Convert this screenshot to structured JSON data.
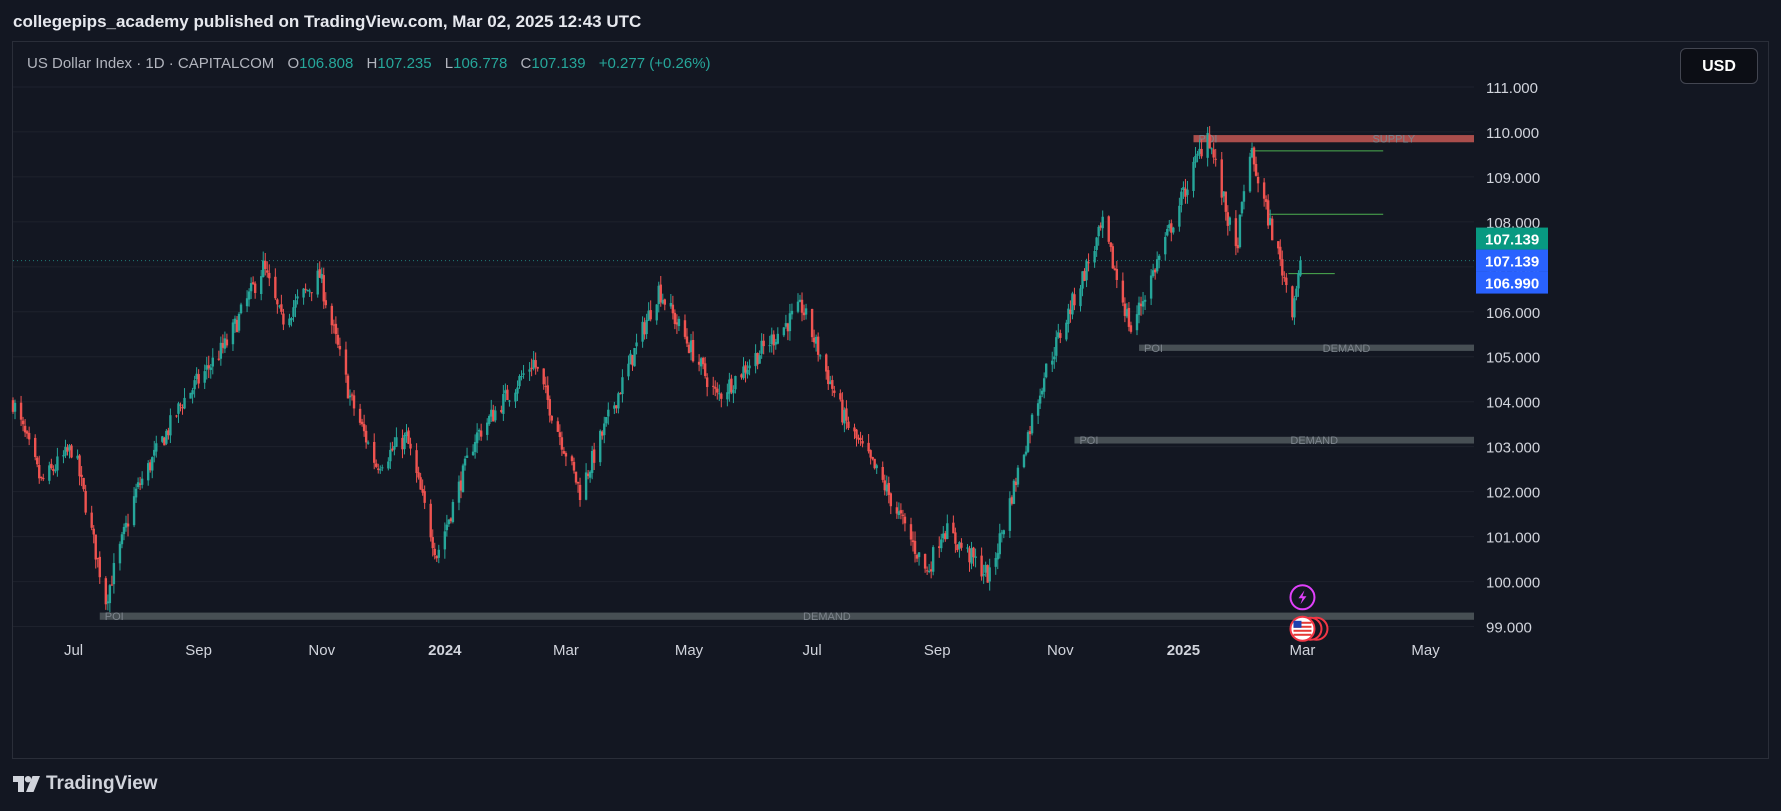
{
  "header": {
    "title": "collegepips_academy published on TradingView.com, Mar 02, 2025 12:43 UTC"
  },
  "legend": {
    "symbol": "US Dollar Index · 1D · CAPITALCOM",
    "o_label": "O",
    "o_value": "106.808",
    "h_label": "H",
    "h_value": "107.235",
    "l_label": "L",
    "l_value": "106.778",
    "c_label": "C",
    "c_value": "107.139",
    "change": "+0.277 (+0.26%)"
  },
  "currency_button": "USD",
  "price_labels": {
    "last": "107.139",
    "close": "107.139",
    "level": "106.990"
  },
  "footer": {
    "brand": "TradingView"
  },
  "colors": {
    "background": "#131722",
    "up": "#26a69a",
    "down": "#ef5350",
    "supply_zone": "#b2514f",
    "demand_zone": "#4a5257",
    "level_line": "#4caf50",
    "price_tag_green": "#089981",
    "price_tag_blue": "#2962ff",
    "event_purple": "#e040fb",
    "event_red": "#f23645"
  },
  "icons": [
    "lightning-event-icon",
    "us-flag-event-icon",
    "tradingview-logo-icon"
  ],
  "chart_data": {
    "type": "candlestick",
    "symbol": "US Dollar Index",
    "interval": "1D",
    "y_ticks": [
      99.0,
      100.0,
      101.0,
      102.0,
      103.0,
      104.0,
      105.0,
      106.0,
      107.0,
      108.0,
      109.0,
      110.0,
      111.0
    ],
    "y_tick_labels": [
      "99.000",
      "100.000",
      "101.000",
      "102.000",
      "103.000",
      "104.000",
      "105.000",
      "106.000",
      "107.000",
      "108.000",
      "109.000",
      "110.000",
      "111.000"
    ],
    "y_range": [
      98.1,
      112.0
    ],
    "x_range": [
      "2023-06-01",
      "2025-05-25"
    ],
    "x_ticks": [
      {
        "date": "2023-07-01",
        "label": "Jul"
      },
      {
        "date": "2023-09-01",
        "label": "Sep"
      },
      {
        "date": "2023-11-01",
        "label": "Nov"
      },
      {
        "date": "2024-01-01",
        "label": "2024"
      },
      {
        "date": "2024-03-01",
        "label": "Mar"
      },
      {
        "date": "2024-05-01",
        "label": "May"
      },
      {
        "date": "2024-07-01",
        "label": "Jul"
      },
      {
        "date": "2024-09-01",
        "label": "Sep"
      },
      {
        "date": "2024-11-01",
        "label": "Nov"
      },
      {
        "date": "2025-01-01",
        "label": "2025"
      },
      {
        "date": "2025-03-01",
        "label": "Mar"
      },
      {
        "date": "2025-05-01",
        "label": "May"
      }
    ],
    "price_path": [
      [
        "2023-06-01",
        104.0
      ],
      [
        "2023-06-15",
        102.2
      ],
      [
        "2023-07-01",
        103.0
      ],
      [
        "2023-07-17",
        99.6
      ],
      [
        "2023-08-01",
        102.0
      ],
      [
        "2023-08-24",
        104.0
      ],
      [
        "2023-09-15",
        105.3
      ],
      [
        "2023-10-03",
        107.0
      ],
      [
        "2023-10-12",
        105.8
      ],
      [
        "2023-10-31",
        106.8
      ],
      [
        "2023-11-15",
        104.1
      ],
      [
        "2023-11-28",
        102.6
      ],
      [
        "2023-12-13",
        103.2
      ],
      [
        "2023-12-28",
        100.6
      ],
      [
        "2024-01-16",
        103.2
      ],
      [
        "2024-02-14",
        104.9
      ],
      [
        "2024-03-08",
        102.0
      ],
      [
        "2024-04-16",
        106.5
      ],
      [
        "2024-05-15",
        104.1
      ],
      [
        "2024-06-26",
        106.1
      ],
      [
        "2024-07-17",
        103.6
      ],
      [
        "2024-08-05",
        102.2
      ],
      [
        "2024-08-27",
        100.2
      ],
      [
        "2024-09-04",
        101.2
      ],
      [
        "2024-09-27",
        100.1
      ],
      [
        "2024-10-24",
        104.6
      ],
      [
        "2024-11-22",
        107.9
      ],
      [
        "2024-12-06",
        105.6
      ],
      [
        "2025-01-13",
        110.0
      ],
      [
        "2025-01-27",
        107.3
      ],
      [
        "2025-02-03",
        109.6
      ],
      [
        "2025-02-24",
        106.1
      ],
      [
        "2025-02-28",
        107.14
      ]
    ],
    "zones": [
      {
        "kind": "supply",
        "start": "2025-01-06",
        "end": "2025-05-25",
        "top": 109.93,
        "bottom": 109.77,
        "labels": [
          "POI",
          "SUPPLY"
        ]
      },
      {
        "kind": "demand",
        "start": "2024-12-10",
        "end": "2025-05-25",
        "top": 105.27,
        "bottom": 105.13,
        "labels": [
          "POI",
          "DEMAND"
        ]
      },
      {
        "kind": "demand",
        "start": "2024-11-08",
        "end": "2025-05-25",
        "top": 103.22,
        "bottom": 103.07,
        "labels": [
          "POI",
          "DEMAND"
        ]
      },
      {
        "kind": "demand",
        "start": "2023-07-14",
        "end": "2025-05-25",
        "top": 99.31,
        "bottom": 99.15,
        "labels": [
          "POI",
          "DEMAND"
        ]
      }
    ],
    "levels": [
      {
        "price": 109.58,
        "start": "2025-02-03",
        "end": "2025-04-10"
      },
      {
        "price": 108.17,
        "start": "2025-02-12",
        "end": "2025-04-10"
      },
      {
        "price": 106.85,
        "start": "2025-02-22",
        "end": "2025-03-17"
      }
    ],
    "last_price": 107.139,
    "events": [
      {
        "type": "lightning",
        "date": "2025-03-01",
        "price": 99.65
      },
      {
        "type": "us-flag",
        "date": "2025-03-01",
        "price": 98.95
      }
    ]
  }
}
